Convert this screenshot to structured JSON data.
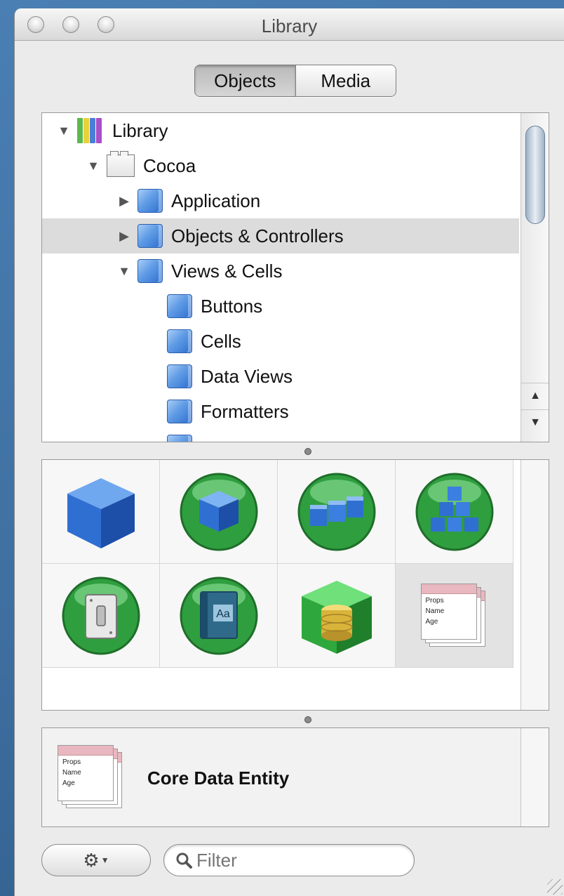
{
  "window": {
    "title": "Library"
  },
  "segmented": {
    "tabs": [
      "Objects",
      "Media"
    ],
    "selected": "Objects"
  },
  "tree": {
    "items": [
      {
        "label": "Library",
        "icon": "library-icon",
        "level": 0,
        "expanded": true
      },
      {
        "label": "Cocoa",
        "icon": "package-icon",
        "level": 1,
        "expanded": true
      },
      {
        "label": "Application",
        "icon": "folder-icon",
        "level": 2,
        "expanded": false
      },
      {
        "label": "Objects & Controllers",
        "icon": "folder-icon",
        "level": 2,
        "expanded": false,
        "selected": true
      },
      {
        "label": "Views & Cells",
        "icon": "folder-icon",
        "level": 2,
        "expanded": true
      },
      {
        "label": "Buttons",
        "icon": "folder-icon",
        "level": 3
      },
      {
        "label": "Cells",
        "icon": "folder-icon",
        "level": 3
      },
      {
        "label": "Data Views",
        "icon": "folder-icon",
        "level": 3
      },
      {
        "label": "Formatters",
        "icon": "folder-icon",
        "level": 3
      }
    ]
  },
  "grid": {
    "icons": [
      "blue-cube-icon",
      "green-sphere-cube-icon",
      "green-sphere-row-cubes-icon",
      "green-sphere-pyramid-cubes-icon",
      "green-sphere-switch-icon",
      "green-sphere-book-icon",
      "green-cube-database-icon",
      "core-data-entity-icon"
    ],
    "selected_index": 7
  },
  "entity_props": {
    "header": "Props",
    "field1": "Name",
    "field2": "Age"
  },
  "detail": {
    "label": "Core Data Entity",
    "icon": "core-data-entity-icon"
  },
  "bottom": {
    "action_icon": "gear-icon",
    "filter_placeholder": "Filter",
    "search_icon": "search-icon"
  },
  "colors": {
    "folder_blue": "#5f9be5",
    "selection": "#dcdcdc",
    "sphere_green": "#39b34a"
  }
}
